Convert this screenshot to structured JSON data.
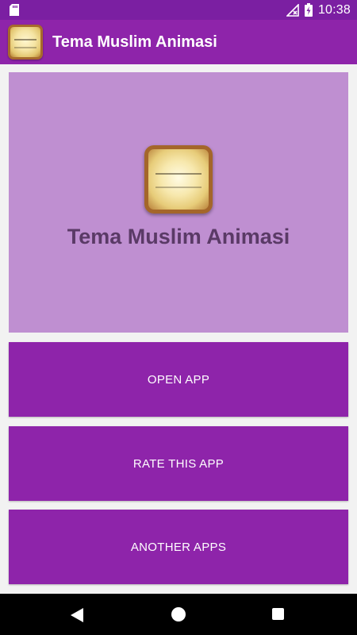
{
  "status_bar": {
    "time": "10:38",
    "icons": [
      "sd-card-icon",
      "no-signal-icon",
      "battery-charging-icon"
    ]
  },
  "app_bar": {
    "title": "Tema Muslim Animasi",
    "icon": "quran-calligraphy-app-icon"
  },
  "hero": {
    "title": "Tema Muslim Animasi",
    "icon": "quran-calligraphy-app-icon"
  },
  "buttons": {
    "open_app": "OPEN APP",
    "rate_app": "RATE THIS APP",
    "another_apps": "ANOTHER APPS"
  },
  "nav_bar": {
    "icons": [
      "back-icon",
      "home-icon",
      "recents-icon"
    ]
  },
  "colors": {
    "status_bar": "#7b1fa2",
    "app_bar": "#8e24aa",
    "hero_background": "#bf8fd1",
    "button": "#8e24aa",
    "hero_title": "#5a3a66"
  }
}
